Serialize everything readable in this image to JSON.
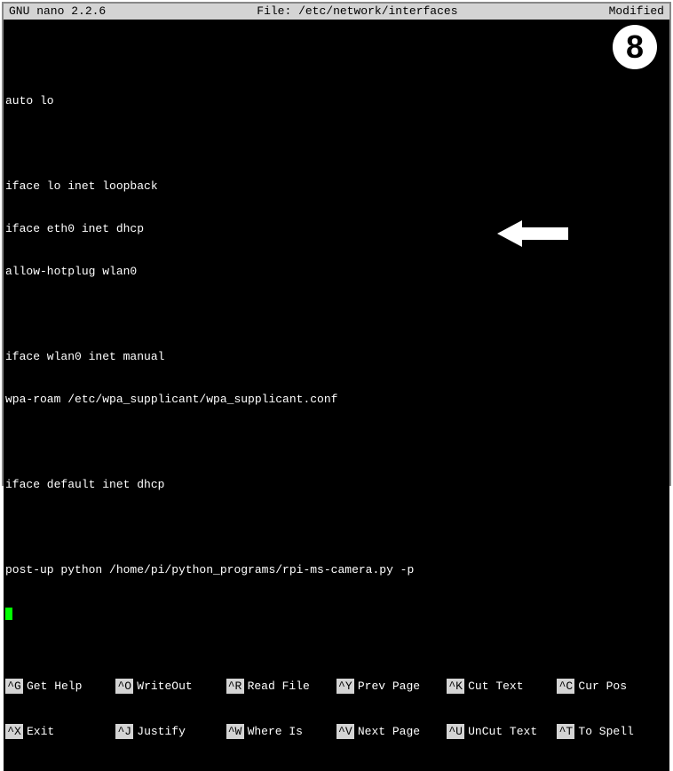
{
  "title_bar": {
    "app": "  GNU nano 2.2.6",
    "file_label": "File: /etc/network/interfaces",
    "status": "Modified"
  },
  "lines": {
    "l0": "",
    "l1": "auto lo",
    "l2": "",
    "l3": "iface lo inet loopback",
    "l4": "iface eth0 inet dhcp",
    "l5": "allow-hotplug wlan0",
    "l6": "",
    "l7": "iface wlan0 inet manual",
    "l8": "wpa-roam /etc/wpa_supplicant/wpa_supplicant.conf",
    "l9": "",
    "l10": "iface default inet dhcp",
    "l11": "",
    "l12": "post-up python /home/pi/python_programs/rpi-ms-camera.py -p"
  },
  "footer": {
    "row1": {
      "k0": "^G",
      "t0": "Get Help",
      "k1": "^O",
      "t1": "WriteOut",
      "k2": "^R",
      "t2": "Read File",
      "k3": "^Y",
      "t3": "Prev Page",
      "k4": "^K",
      "t4": "Cut Text",
      "k5": "^C",
      "t5": "Cur Pos"
    },
    "row2": {
      "k0": "^X",
      "t0": "Exit",
      "k1": "^J",
      "t1": "Justify",
      "k2": "^W",
      "t2": "Where Is",
      "k3": "^V",
      "t3": "Next Page",
      "k4": "^U",
      "t4": "UnCut Text",
      "k5": "^T",
      "t5": "To Spell"
    }
  },
  "annotations": {
    "badge": "8"
  }
}
